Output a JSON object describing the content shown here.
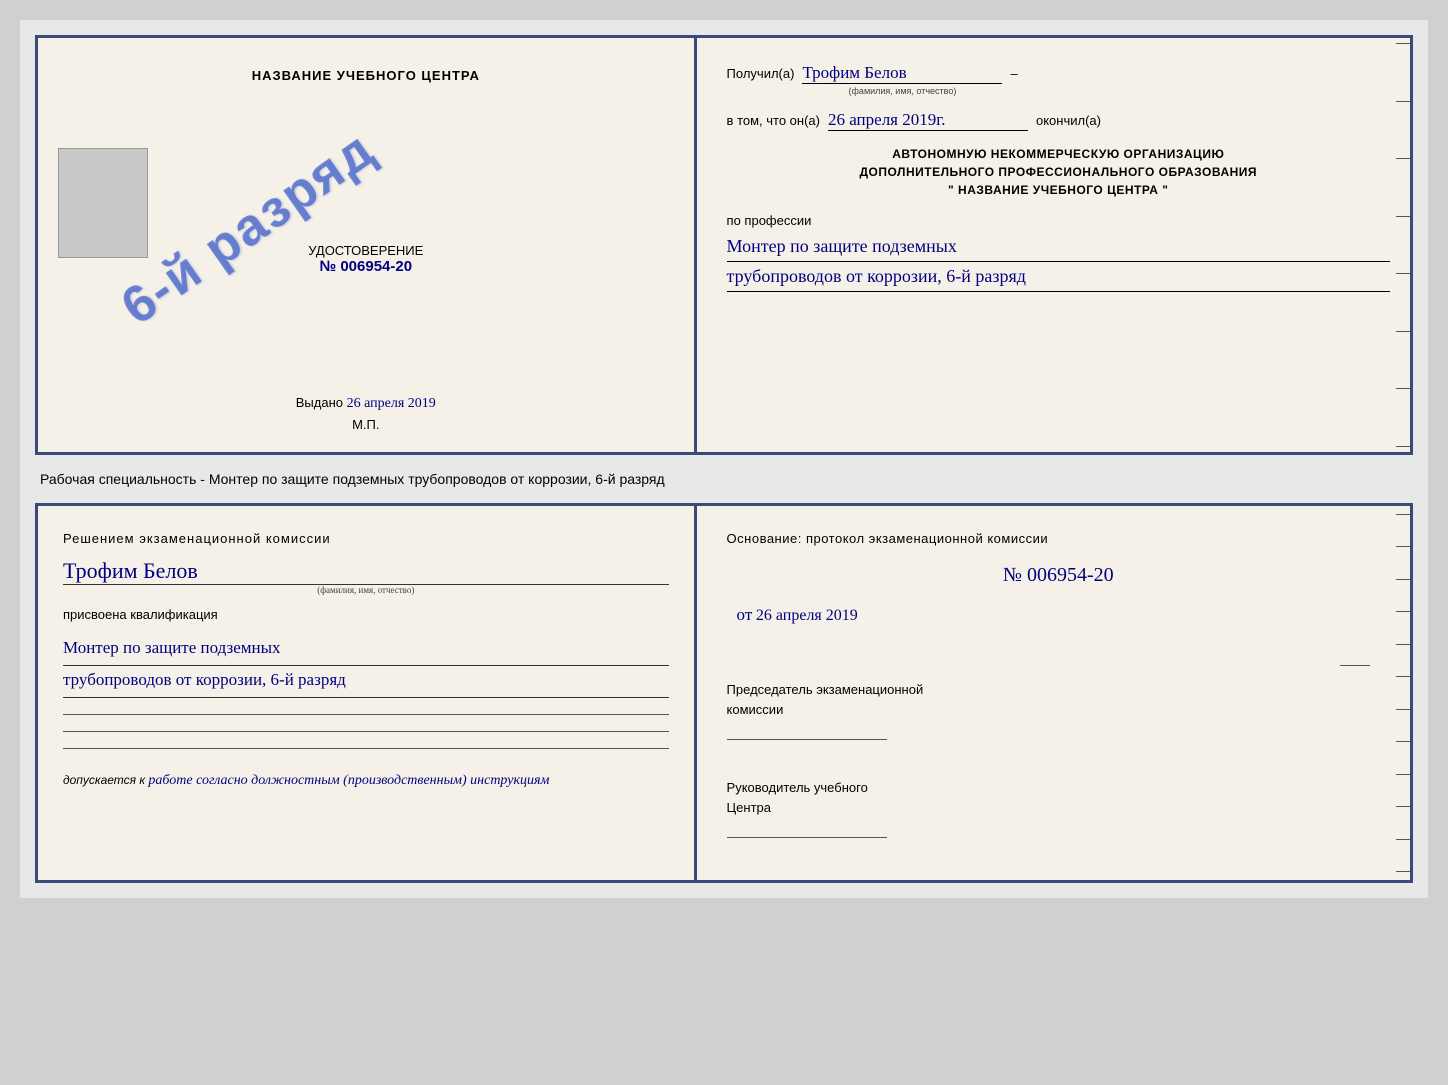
{
  "top_cert": {
    "left": {
      "title": "НАЗВАНИЕ УЧЕБНОГО ЦЕНТРА",
      "stamp_line1": "6-й",
      "stamp_line2": "разряд",
      "udost_label": "УДОСТОВЕРЕНИЕ",
      "number": "№ 006954-20",
      "vydano_label": "Выдано",
      "vydano_date": "26 апреля 2019",
      "mp_label": "М.П."
    },
    "right": {
      "poluchil_label": "Получил(а)",
      "name_handwritten": "Трофим Белов",
      "name_small_label": "(фамилия, имя, отчество)",
      "dash": "–",
      "vtom_label": "в том, что он(а)",
      "date_handwritten": "26 апреля 2019г.",
      "okonchil_label": "окончил(а)",
      "org_line1": "АВТОНОМНУЮ НЕКОММЕРЧЕСКУЮ ОРГАНИЗАЦИЮ",
      "org_line2": "ДОПОЛНИТЕЛЬНОГО ПРОФЕССИОНАЛЬНОГО ОБРАЗОВАНИЯ",
      "org_line3": "\"  НАЗВАНИЕ УЧЕБНОГО ЦЕНТРА  \"",
      "po_professii": "по профессии",
      "profession_line1": "Монтер по защите подземных",
      "profession_line2": "трубопроводов от коррозии, 6-й разряд"
    }
  },
  "specialty_text": "Рабочая специальность - Монтер по защите подземных трубопроводов от коррозии, 6-й разряд",
  "bottom_cert": {
    "left": {
      "resheniyem": "Решением  экзаменационной  комиссии",
      "name_handwritten": "Трофим Белов",
      "name_small": "(фамилия, имя, отчество)",
      "prisvoena": "присвоена квалификация",
      "qual_line1": "Монтер по защите подземных",
      "qual_line2": "трубопроводов от коррозии, 6-й разряд",
      "dopuskaetsya_label": "допускается к",
      "dopuskaetsya_text": "работе согласно должностным (производственным) инструкциям"
    },
    "right": {
      "osnovanie": "Основание: протокол экзаменационной  комиссии",
      "number": "№  006954-20",
      "ot_label": "от",
      "ot_date": "26 апреля 2019",
      "predsedatel_line1": "Председатель экзаменационной",
      "predsedatel_line2": "комиссии",
      "rukovoditel_line1": "Руководитель учебного",
      "rukovoditel_line2": "Центра"
    }
  }
}
